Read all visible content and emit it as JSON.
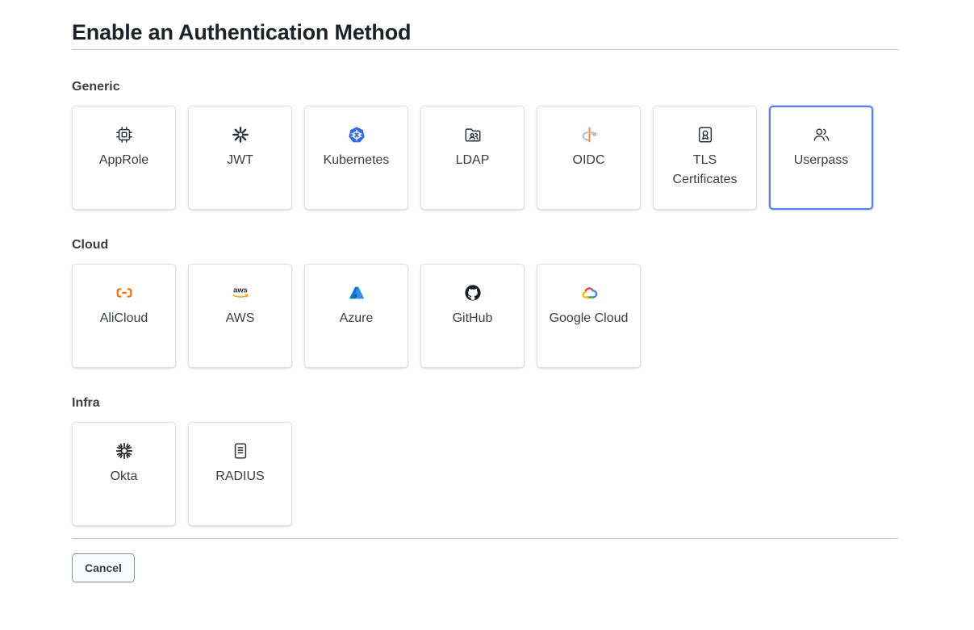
{
  "page": {
    "title": "Enable an Authentication Method"
  },
  "sections": [
    {
      "heading": "Generic",
      "methods": [
        {
          "label": "AppRole",
          "icon": "cpu-chip-icon"
        },
        {
          "label": "JWT",
          "icon": "jwt-icon"
        },
        {
          "label": "Kubernetes",
          "icon": "kubernetes-icon"
        },
        {
          "label": "LDAP",
          "icon": "folder-users-icon"
        },
        {
          "label": "OIDC",
          "icon": "openid-icon"
        },
        {
          "label": "TLS Certificates",
          "icon": "certificate-icon"
        },
        {
          "label": "Userpass",
          "icon": "users-icon",
          "selected": true
        }
      ]
    },
    {
      "heading": "Cloud",
      "methods": [
        {
          "label": "AliCloud",
          "icon": "alibaba-cloud-icon"
        },
        {
          "label": "AWS",
          "icon": "aws-icon"
        },
        {
          "label": "Azure",
          "icon": "azure-icon"
        },
        {
          "label": "GitHub",
          "icon": "github-icon"
        },
        {
          "label": "Google Cloud",
          "icon": "google-cloud-icon"
        }
      ]
    },
    {
      "heading": "Infra",
      "methods": [
        {
          "label": "Okta",
          "icon": "okta-icon"
        },
        {
          "label": "RADIUS",
          "icon": "radius-server-icon"
        }
      ]
    }
  ],
  "actions": {
    "cancel_label": "Cancel"
  },
  "colors": {
    "selected_border": "#5b7df0",
    "kubernetes_blue": "#326ce5",
    "alicloud_orange": "#ff6a00",
    "aws_orange": "#ff9900",
    "azure_blue": "#0078d4",
    "openid_orange": "#f78c40"
  }
}
